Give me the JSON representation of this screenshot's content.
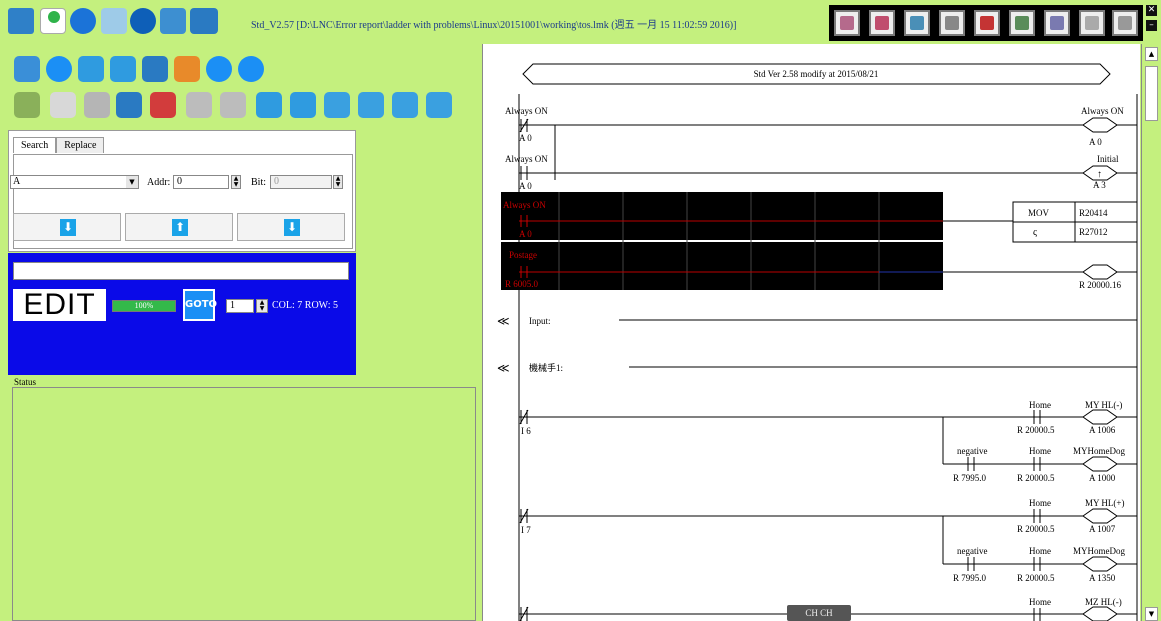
{
  "window": {
    "title": "Std_V2.57 [D:\\LNC\\Error report\\ladder with problems\\Linux\\20151001\\working\\tos.lmk (週五 一月 15 11:02:59 2016)]",
    "close_glyph": "✕",
    "minimize_glyph": "–"
  },
  "search_panel": {
    "tabs": [
      "Search",
      "Replace"
    ],
    "device_value": "A",
    "addr_label": "Addr:",
    "addr_value": "0",
    "bit_label": "Bit:",
    "bit_value": "0",
    "buttons": [
      "find-down",
      "find-up",
      "find-next"
    ],
    "arrow_glyphs": [
      "⬇",
      "⬆",
      "⬇"
    ]
  },
  "edit_panel": {
    "mode": "EDIT",
    "progress_text": "100%",
    "progress_fraction": 1.0,
    "goto_label": "GOTO",
    "row_value": "1",
    "col_row_text": "COL: 7 ROW: 5"
  },
  "status": {
    "label": "Status"
  },
  "ladder": {
    "header_text": "Std Ver 2.58 modify at 2015/08/21",
    "comments": [
      "Input:",
      "機械手1:"
    ],
    "labels": {
      "always_on": "Always ON",
      "initial": "Initial",
      "postage": "Postage",
      "home": "Home",
      "negative": "negative",
      "my_hl_minus": "MY HL(-)",
      "my_hl_plus": "MY HL(+)",
      "my_home_dog": "MYHomeDog",
      "mz_hl_minus": "MZ HL(-)",
      "mov": "MOV"
    },
    "addresses": {
      "a0": "A 0",
      "a3": "A 3",
      "r20414": "R20414",
      "r27012": "R27012",
      "r_postage": "R 6005.0",
      "r20000_16": "R 20000.16",
      "i6": "I 6",
      "i7": "I 7",
      "r20000_5": "R 20000.5",
      "r7995_0": "R 7995.0",
      "a1006": "A 1006",
      "a1000": "A 1000",
      "a1007": "A 1007",
      "a1350": "A 1350"
    },
    "comment_glyph": "≪"
  },
  "bottom_bar": {
    "label": "CH CH"
  },
  "colors": {
    "background": "#c4f07e",
    "edit_panel": "#0a0ae8",
    "goto": "#1b8ff5",
    "highlight_block": "#000000",
    "highlight_text": "#cc0000"
  }
}
